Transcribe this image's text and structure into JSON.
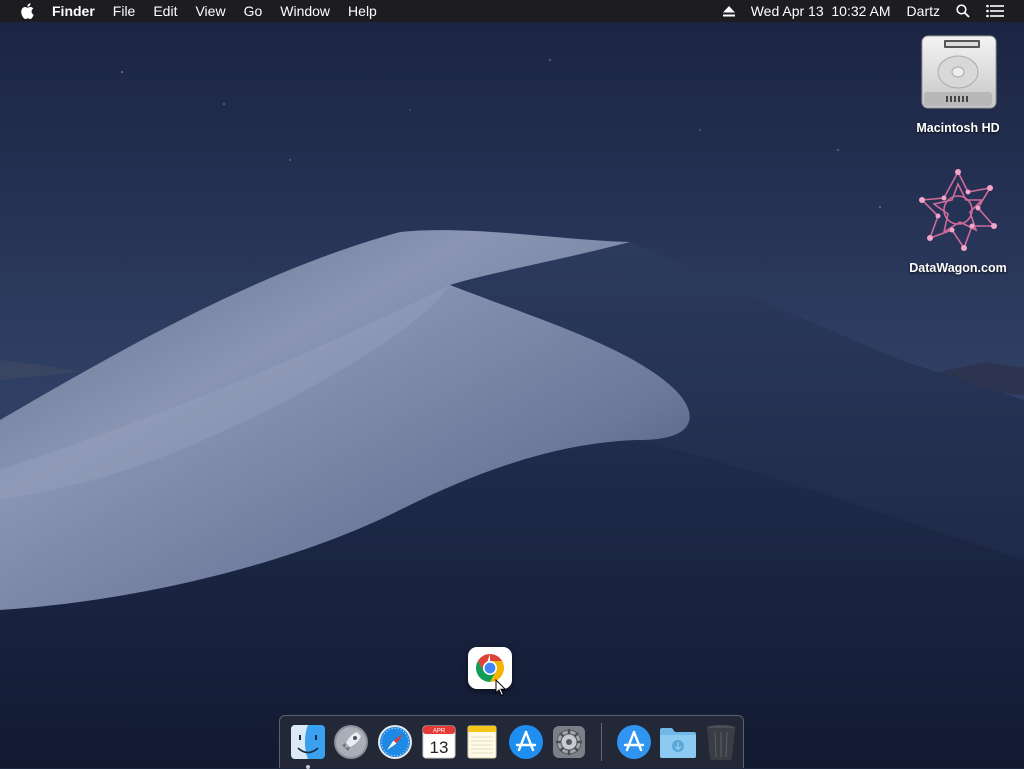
{
  "menubar": {
    "app_name": "Finder",
    "menus": [
      "File",
      "Edit",
      "View",
      "Go",
      "Window",
      "Help"
    ],
    "clock": "Wed Apr 13  10:32 AM",
    "user": "Dartz"
  },
  "desktop_icons": [
    {
      "label": "Macintosh HD",
      "icon": "hard-drive-icon"
    },
    {
      "label": "DataWagon.com",
      "icon": "datawagon-icon"
    }
  ],
  "floating_icon": {
    "icon": "chrome-icon"
  },
  "dock": {
    "items": [
      {
        "name": "Finder",
        "icon": "finder-icon",
        "running": true
      },
      {
        "name": "Launchpad",
        "icon": "launchpad-icon"
      },
      {
        "name": "Safari",
        "icon": "safari-icon"
      },
      {
        "name": "Calendar",
        "icon": "calendar-icon",
        "month": "APR",
        "day": "13"
      },
      {
        "name": "Notes",
        "icon": "notes-icon"
      },
      {
        "name": "App Store",
        "icon": "app-store-icon"
      },
      {
        "name": "System Preferences",
        "icon": "system-preferences-icon"
      },
      {
        "name": "Applications",
        "icon": "applications-icon"
      },
      {
        "name": "Downloads",
        "icon": "downloads-folder-icon"
      },
      {
        "name": "Trash",
        "icon": "trash-icon"
      }
    ]
  },
  "colors": {
    "sky_top": "#1c2440",
    "sky_bottom": "#3a4a6e",
    "dune_light": "#8b97b4",
    "dune_dark": "#1e2a4a",
    "menubar_bg": "#1c1c1e"
  }
}
